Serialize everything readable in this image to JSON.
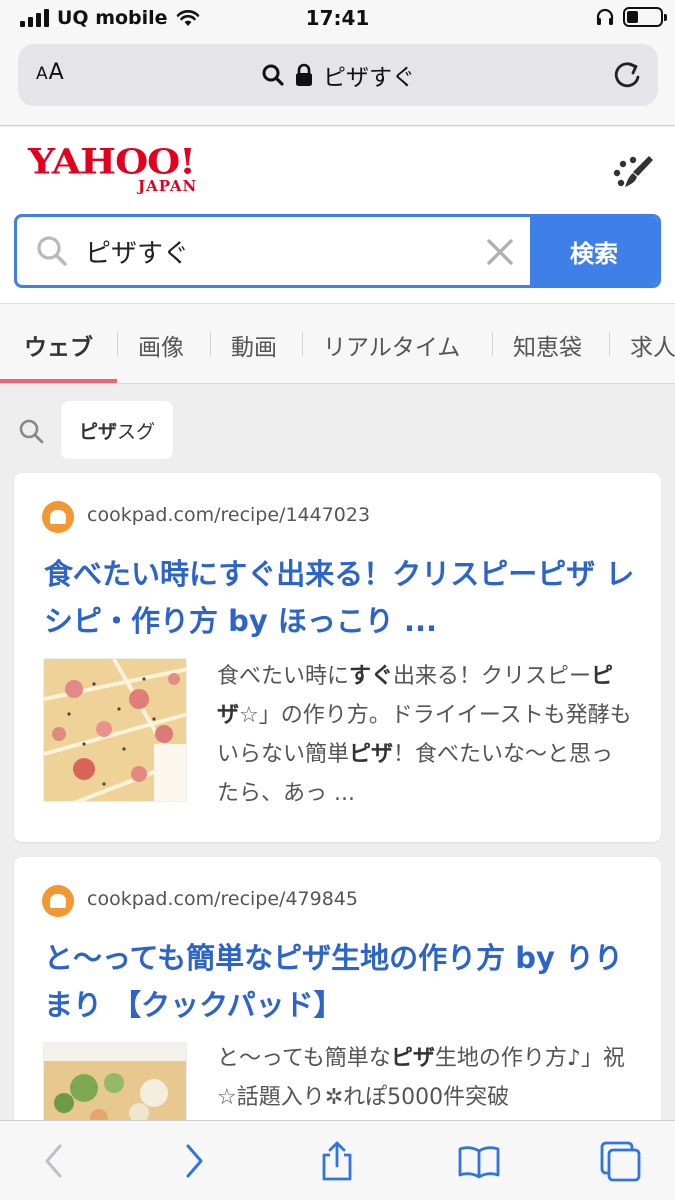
{
  "status_bar": {
    "carrier": "UQ mobile",
    "time": "17:41",
    "battery_level": 0.35
  },
  "browser": {
    "text_size_label_small": "A",
    "text_size_label_large": "A",
    "address_text": "ピザすぐ"
  },
  "yahoo": {
    "logo_main": "YAHOO!",
    "logo_sub": "JAPAN",
    "search_query": "ピザすぐ",
    "search_button": "検索",
    "accent_color": "#3f7fe8",
    "brand_color": "#e3001e"
  },
  "tabs": [
    {
      "label": "ウェブ",
      "active": true
    },
    {
      "label": "画像",
      "active": false
    },
    {
      "label": "動画",
      "active": false
    },
    {
      "label": "リアルタイム",
      "active": false
    },
    {
      "label": "知恵袋",
      "active": false
    },
    {
      "label": "求人",
      "active": false
    }
  ],
  "suggestion": {
    "bold": "ピザ",
    "rest": "スグ"
  },
  "results": [
    {
      "url": "cookpad.com/recipe/1447023",
      "title": "食べたい時にすぐ出来る！クリスピーピザ レシピ・作り方 by ほっこり ...",
      "snippet": [
        {
          "t": "食べたい時に",
          "b": false
        },
        {
          "t": "すぐ",
          "b": true
        },
        {
          "t": "出来る！クリスピー",
          "b": false
        },
        {
          "t": "ピザ",
          "b": true
        },
        {
          "t": "☆」の作り方。ドライイーストも発酵もいらない簡単",
          "b": false
        },
        {
          "t": "ピザ",
          "b": true
        },
        {
          "t": "！食べたいな〜と思ったら、あっ ...",
          "b": false
        }
      ]
    },
    {
      "url": "cookpad.com/recipe/479845",
      "title": "と〜っても簡単なピザ生地の作り方 by りりまり 【クックパッド】",
      "snippet": [
        {
          "t": "と〜っても簡単な",
          "b": false
        },
        {
          "t": "ピザ",
          "b": true
        },
        {
          "t": "生地の作り方♪」祝☆話題入り✲れぽ5000件突破",
          "b": false
        }
      ]
    }
  ],
  "toolbar": {
    "icons": [
      "back-icon",
      "forward-icon",
      "share-icon",
      "bookmarks-icon",
      "tabs-icon"
    ]
  }
}
